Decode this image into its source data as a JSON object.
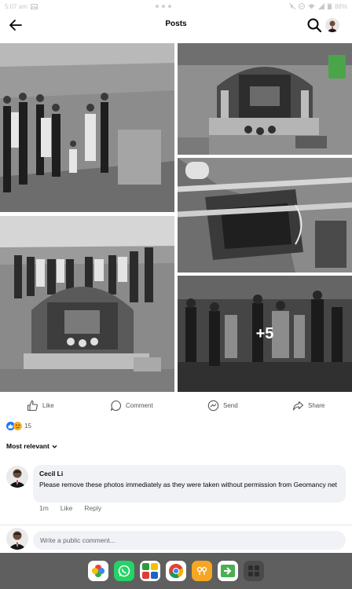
{
  "status_bar": {
    "time": "5:07 am",
    "battery": "88%"
  },
  "header": {
    "title": "Posts"
  },
  "icons": {
    "back": "arrow-left-icon",
    "search": "search-icon",
    "like": "thumbs-up-icon",
    "comment": "comment-bubble-icon",
    "send": "messenger-icon",
    "share": "share-arrow-icon"
  },
  "photos": {
    "more_count": "+5"
  },
  "actions": {
    "like": "Like",
    "comment": "Comment",
    "send": "Send",
    "share": "Share"
  },
  "reactions": {
    "count": "15"
  },
  "sort": {
    "label": "Most relevant"
  },
  "comment": {
    "author": "Cecil Li",
    "text": "Please remove these photos immediately as they were taken without permission from Geomancy net",
    "time": "1m",
    "like": "Like",
    "reply": "Reply"
  },
  "composer": {
    "placeholder": "Write a public comment..."
  },
  "colors": {
    "facebook_blue": "#1877f2",
    "dock_bg": "#5f5f5f",
    "bubble_bg": "#f0f2f5"
  },
  "dock": [
    "google-photos-icon",
    "whatsapp-icon",
    "mtr-app-icon",
    "chrome-icon",
    "maps-icon",
    "pushbullet-icon",
    "app-drawer-icon"
  ]
}
